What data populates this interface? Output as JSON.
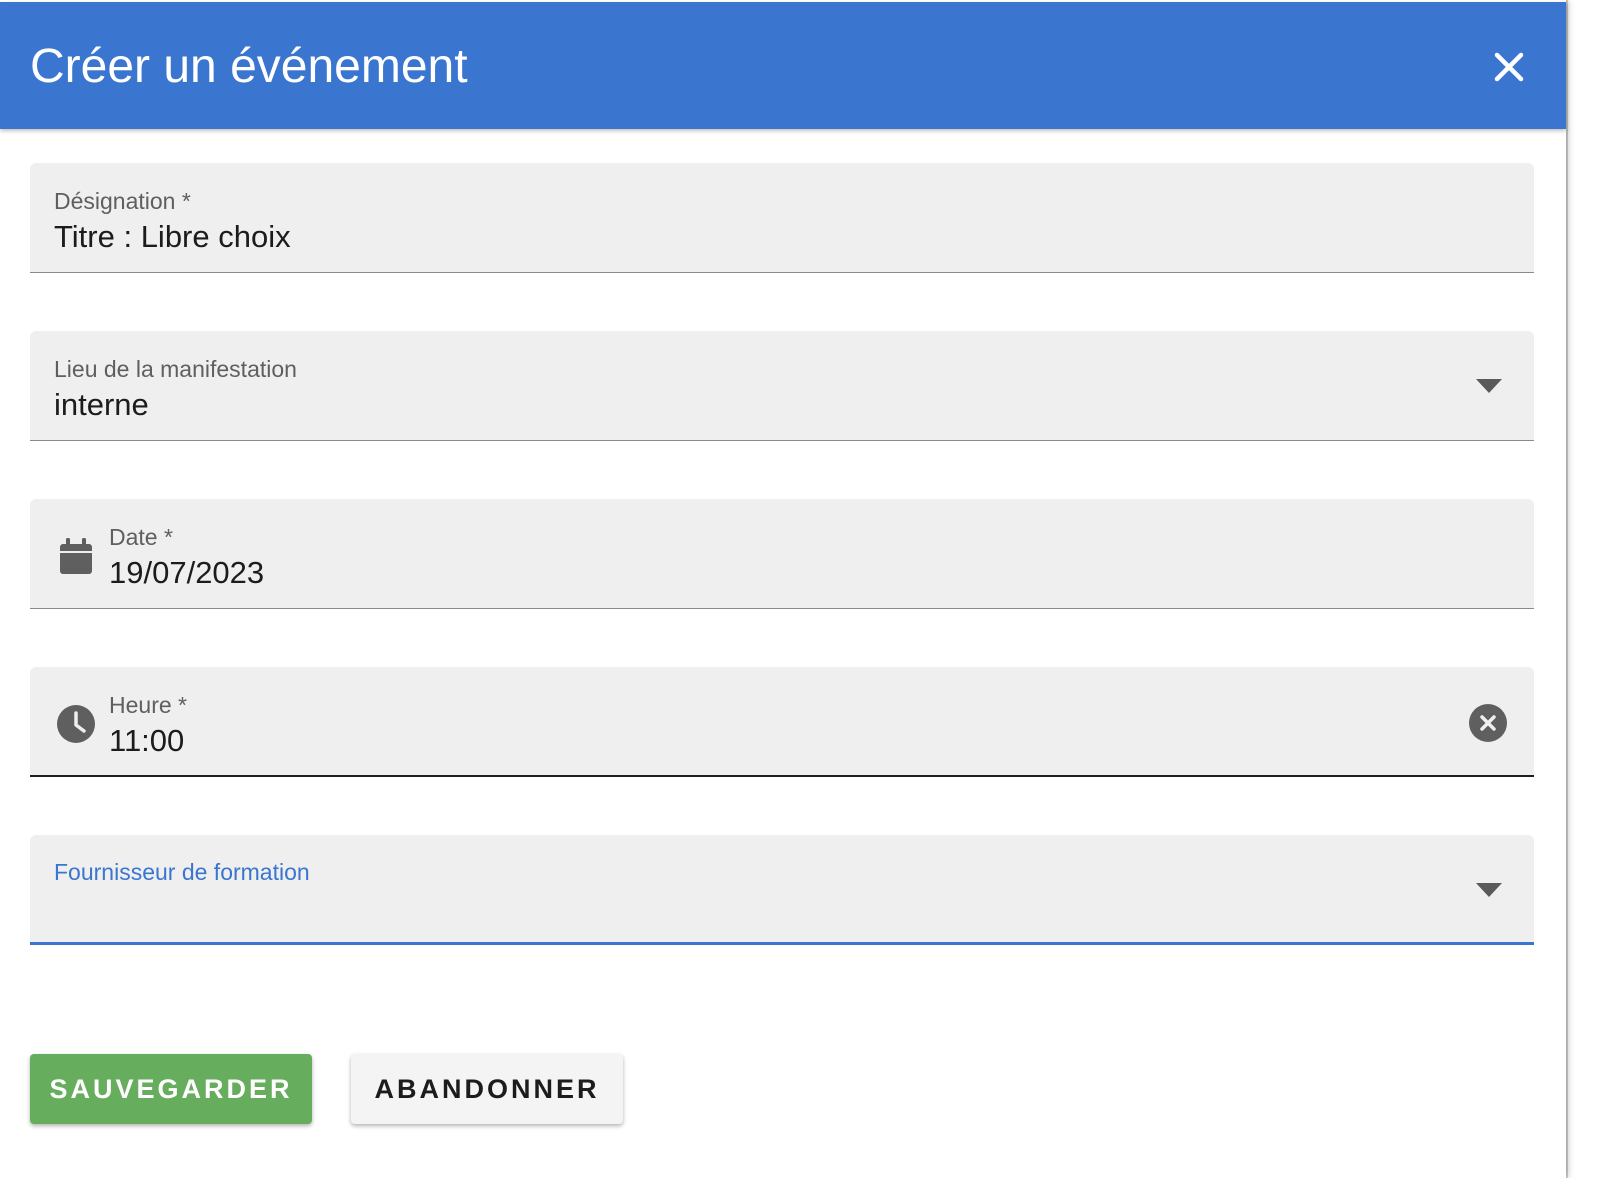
{
  "dialog": {
    "title": "Créer un événement"
  },
  "fields": {
    "designation": {
      "label": "Désignation *",
      "value": "Titre : Libre choix"
    },
    "lieu": {
      "label": "Lieu de la manifestation",
      "value": "interne"
    },
    "date": {
      "label": "Date *",
      "value": "19/07/2023"
    },
    "heure": {
      "label": "Heure *",
      "value": "11:00"
    },
    "fournisseur": {
      "label": "Fournisseur de formation",
      "value": ""
    }
  },
  "actions": {
    "save_label": "SAUVEGARDER",
    "cancel_label": "ABANDONNER"
  },
  "colors": {
    "header": "#3a75cf",
    "save_button": "#66ad5d",
    "focus": "#3a75cf",
    "field_bg": "#efefef"
  },
  "icons": {
    "close": "close-icon",
    "date": "calendar-icon",
    "time": "clock-icon",
    "clear": "clear-icon",
    "dropdown": "caret-down-icon"
  }
}
